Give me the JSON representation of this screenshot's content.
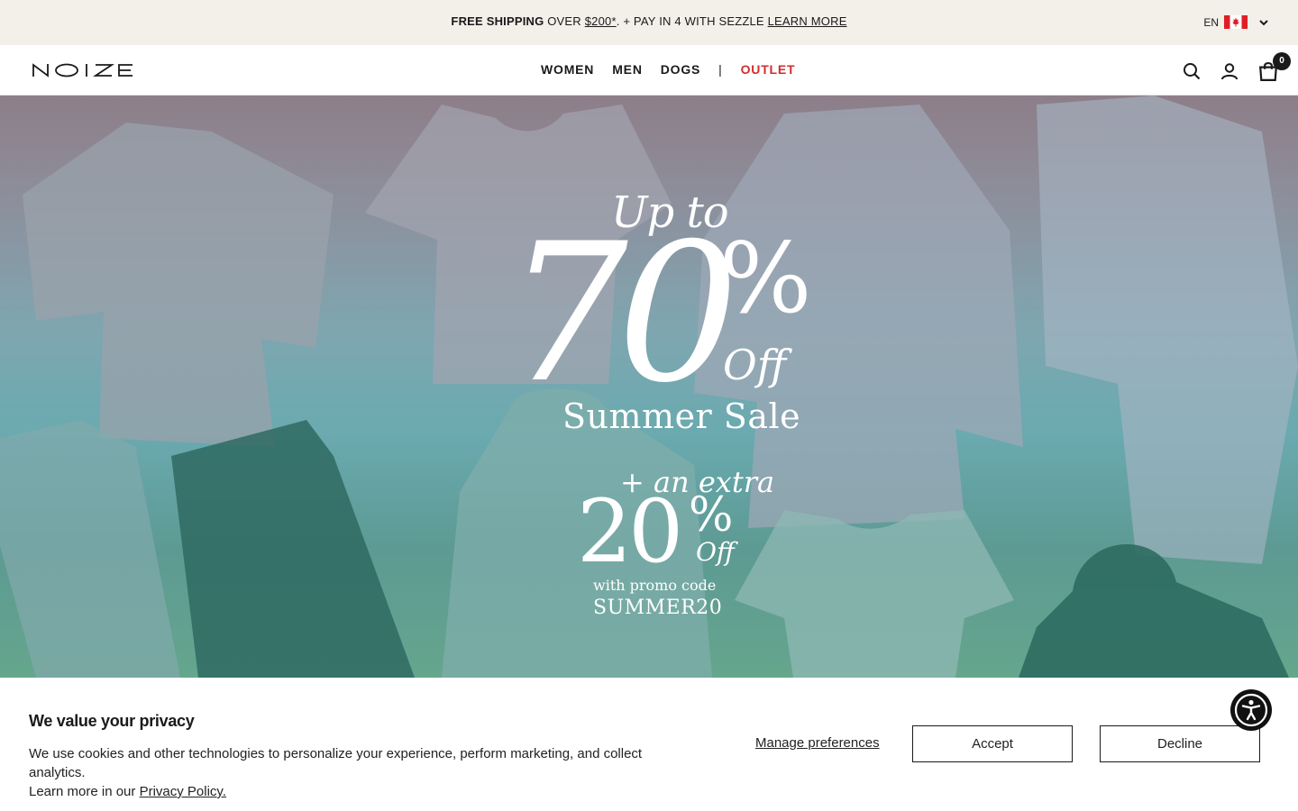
{
  "announcement": {
    "lead": "FREE SHIPPING",
    "over": "OVER",
    "amount": "$200*",
    "middle": ". + PAY IN 4 WITH SEZZLE",
    "link": "LEARN MORE"
  },
  "locale": {
    "language": "EN",
    "flag_icon": "canada-flag-icon"
  },
  "header": {
    "nav": [
      "WOMEN",
      "MEN",
      "DOGS",
      "OUTLET"
    ],
    "separator": "|",
    "cart_count": "0"
  },
  "hero": {
    "upto": "Up to",
    "big_number": "70",
    "big_percent": "%",
    "big_off": "Off",
    "headline": "Summer Sale",
    "extra": "+ an extra",
    "extra_number": "20",
    "extra_percent": "%",
    "extra_off": "Off",
    "promo_text": "with promo code",
    "promo_code": "SUMMER20"
  },
  "cookie": {
    "title": "We value your privacy",
    "body_line1": "We use cookies and other technologies to personalize your experience, perform marketing, and collect analytics.",
    "body_line2_prefix": "Learn more in our",
    "policy_link": "Privacy Policy.",
    "manage": "Manage preferences",
    "accept": "Accept",
    "decline": "Decline"
  },
  "colors": {
    "accent_outlet": "#d12d2d",
    "announcement_bg": "#f3efe9",
    "hero_top": "#8d7e88",
    "hero_bottom": "#65a68d"
  }
}
